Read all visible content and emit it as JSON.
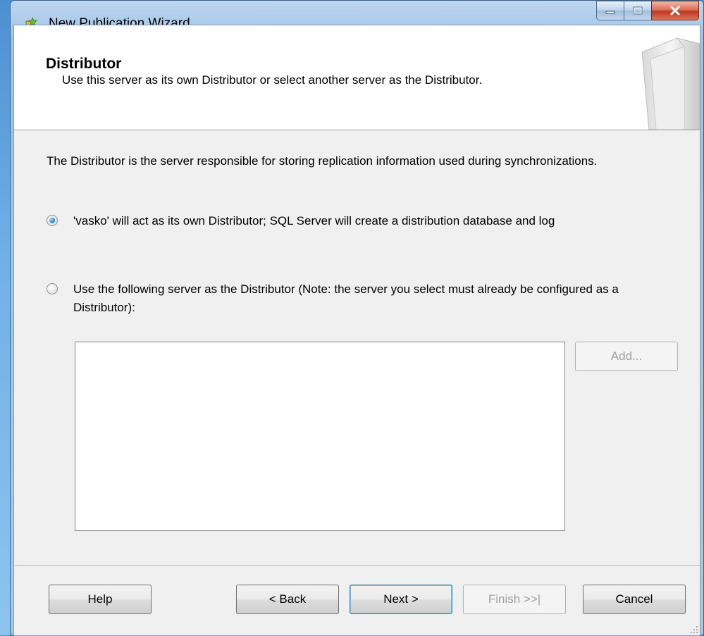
{
  "window": {
    "title": "New Publication Wizard"
  },
  "header": {
    "title": "Distributor",
    "subtitle": "Use this server as its own Distributor or select another server as the Distributor."
  },
  "content": {
    "intro": "The Distributor is the server responsible for storing replication information used during synchronizations.",
    "options": [
      {
        "label": "'vasko' will act as its own Distributor; SQL Server will create a distribution database and log",
        "checked": true
      },
      {
        "label": "Use the following server as the Distributor (Note: the server you select must already be configured as a Distributor):",
        "checked": false
      }
    ],
    "add_button": "Add..."
  },
  "footer": {
    "help": "Help",
    "back": "< Back",
    "next": "Next >",
    "finish": "Finish >>|",
    "cancel": "Cancel"
  }
}
